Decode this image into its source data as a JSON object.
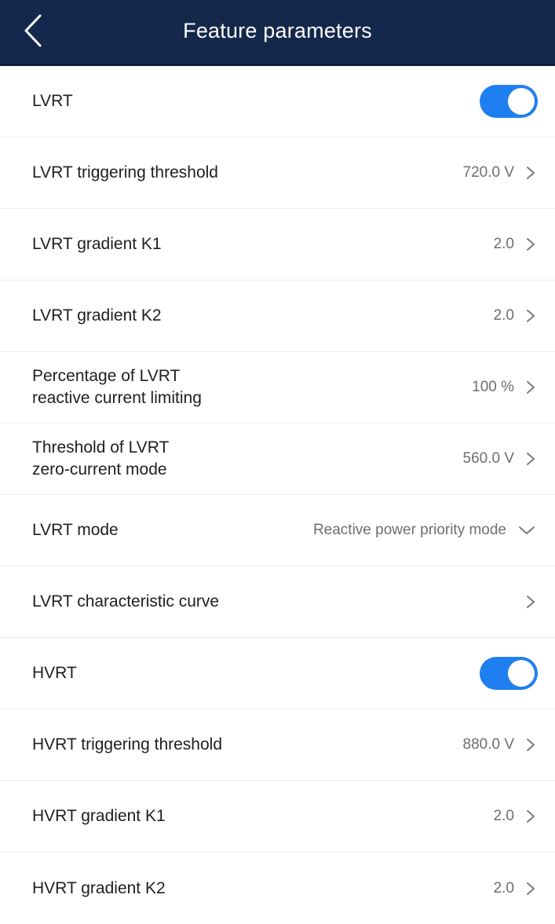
{
  "header": {
    "title": "Feature parameters",
    "back_icon": "chevron-left-icon",
    "background": "#14284b"
  },
  "accent_color": "#1f7ff0",
  "rows": [
    {
      "label": "LVRT",
      "type": "toggle",
      "on": true
    },
    {
      "label": "LVRT triggering threshold",
      "value": "720.0 V",
      "icon": "chevron-right-icon"
    },
    {
      "label": "LVRT gradient K1",
      "value": "2.0",
      "icon": "chevron-right-icon"
    },
    {
      "label": "LVRT gradient K2",
      "value": "2.0",
      "icon": "chevron-right-icon"
    },
    {
      "label": "Percentage of LVRT\nreactive current limiting",
      "value": "100 %",
      "icon": "chevron-right-icon"
    },
    {
      "label": "Threshold of LVRT\nzero-current mode",
      "value": "560.0 V",
      "icon": "chevron-right-icon"
    },
    {
      "label": "LVRT mode",
      "value": "Reactive power priority mode",
      "icon": "chevron-down-icon"
    },
    {
      "label": "LVRT characteristic curve",
      "value": "",
      "icon": "chevron-right-icon"
    },
    {
      "label": "HVRT",
      "type": "toggle",
      "on": true
    },
    {
      "label": "HVRT triggering threshold",
      "value": "880.0 V",
      "icon": "chevron-right-icon"
    },
    {
      "label": "HVRT gradient K1",
      "value": "2.0",
      "icon": "chevron-right-icon"
    },
    {
      "label": "HVRT gradient K2",
      "value": "2.0",
      "icon": "chevron-right-icon"
    }
  ]
}
